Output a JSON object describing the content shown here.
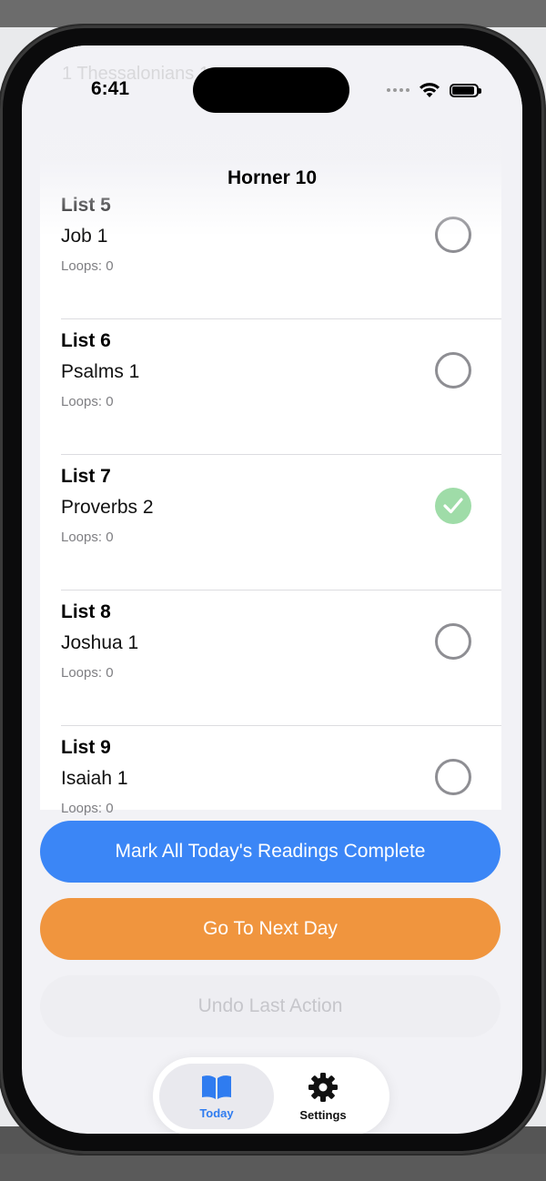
{
  "status_bar": {
    "time": "6:41"
  },
  "nav": {
    "title": "Horner 10"
  },
  "ghost": {
    "text": "1 Thessalonians 1"
  },
  "lists": [
    {
      "name": "List 5",
      "passage": "Job 1",
      "loops": "Loops: 0",
      "completed": false
    },
    {
      "name": "List 6",
      "passage": "Psalms 1",
      "loops": "Loops: 0",
      "completed": false
    },
    {
      "name": "List 7",
      "passage": "Proverbs 2",
      "loops": "Loops: 0",
      "completed": true
    },
    {
      "name": "List 8",
      "passage": "Joshua 1",
      "loops": "Loops: 0",
      "completed": false
    },
    {
      "name": "List 9",
      "passage": "Isaiah 1",
      "loops": "Loops: 0",
      "completed": false
    }
  ],
  "actions": {
    "mark_all": "Mark All Today's Readings Complete",
    "next_day": "Go To Next Day",
    "undo": "Undo Last Action"
  },
  "tabs": [
    {
      "label": "Today",
      "icon": "book-icon",
      "active": true
    },
    {
      "label": "Settings",
      "icon": "gear-icon",
      "active": false
    }
  ],
  "colors": {
    "accent_blue": "#3b86f6",
    "accent_orange": "#f0953e",
    "complete_green": "#9fdca8",
    "tab_active": "#2f7cf0"
  }
}
